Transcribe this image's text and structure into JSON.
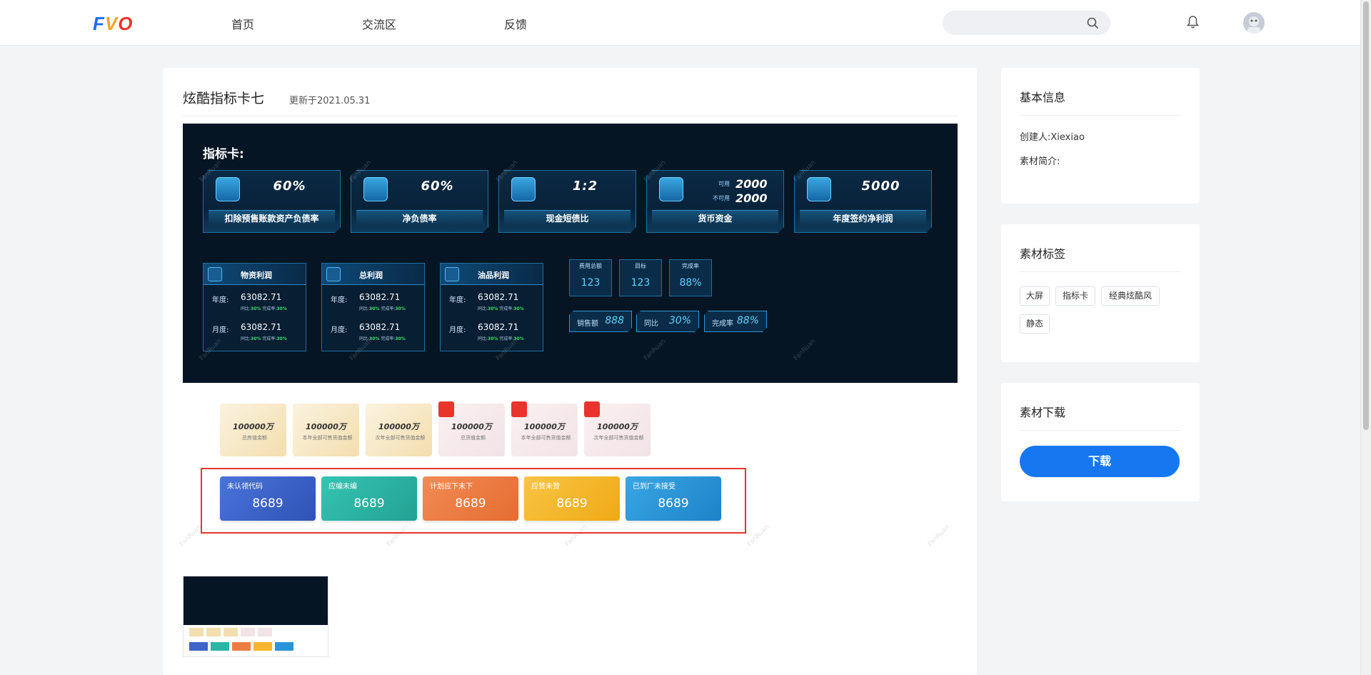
{
  "header": {
    "logo": {
      "p1": "F",
      "p2": "V",
      "p3": "O"
    },
    "nav": [
      {
        "label": "首页"
      },
      {
        "label": "交流区"
      },
      {
        "label": "反馈"
      }
    ],
    "search": {
      "placeholder": ""
    }
  },
  "detail": {
    "title": "炫酷指标卡七",
    "updated": "更新于2021.05.31"
  },
  "preview": {
    "heading": "指标卡:",
    "watermark": "FanRuan",
    "kpis": [
      {
        "value": "60%",
        "label": "扣除预售账款资产负债率"
      },
      {
        "value": "60%",
        "label": "净负债率"
      },
      {
        "value": "1:2",
        "label": "现金短债比"
      },
      {
        "label": "货币资金",
        "rows": [
          {
            "l": "可用",
            "v": "2000"
          },
          {
            "l": "不可用",
            "v": "2000"
          }
        ]
      },
      {
        "value": "5000",
        "label": "年度签约净利润"
      }
    ],
    "profit_cards": [
      {
        "title": "物资利润",
        "year_label": "年度:",
        "year_value": "63082.71",
        "month_label": "月度:",
        "month_value": "63082.71",
        "yoy_label": "同比:",
        "yoy": "30%",
        "rate_label": "完成率:",
        "rate": "30%"
      },
      {
        "title": "总利润",
        "year_label": "年度:",
        "year_value": "63082.71",
        "month_label": "月度:",
        "month_value": "63082.71",
        "yoy_label": "同比:",
        "yoy": "30%",
        "rate_label": "完成率:",
        "rate": "30%"
      },
      {
        "title": "油品利润",
        "year_label": "年度:",
        "year_value": "63082.71",
        "month_label": "月度:",
        "month_value": "63082.71",
        "yoy_label": "同比:",
        "yoy": "30%",
        "rate_label": "完成率:",
        "rate": "30%"
      }
    ],
    "minis": [
      {
        "label": "费用总额",
        "value": "123"
      },
      {
        "label": "目标",
        "value": "123"
      },
      {
        "label": "完成率",
        "value": "88%"
      }
    ],
    "pills": [
      {
        "label": "销售额",
        "value": "888"
      },
      {
        "label": "同比",
        "value": "30%"
      },
      {
        "label": "完成率",
        "value": "88%"
      }
    ],
    "light_cards": [
      {
        "value": "100000万",
        "label": "总房值金额"
      },
      {
        "value": "100000万",
        "label": "本年全部可售货值金额"
      },
      {
        "value": "100000万",
        "label": "次年全部可售货值金额"
      },
      {
        "value": "100000万",
        "label": "总货值金额"
      },
      {
        "value": "100000万",
        "label": "本年全部可售货值金额"
      },
      {
        "value": "100000万",
        "label": "次年全部可售货值金额"
      }
    ],
    "color_cards": [
      {
        "title": "未认领代码",
        "value": "8689"
      },
      {
        "title": "应编未编",
        "value": "8689"
      },
      {
        "title": "计划应下未下",
        "value": "8689"
      },
      {
        "title": "应赞未赞",
        "value": "8689"
      },
      {
        "title": "已到厂未接受",
        "value": "8689"
      }
    ]
  },
  "sidebar": {
    "basic": {
      "heading": "基本信息",
      "creator": "创建人:Xiexiao",
      "intro": "素材简介:"
    },
    "tags": {
      "heading": "素材标签",
      "items": [
        "大屏",
        "指标卡",
        "经典炫酷风",
        "静态"
      ]
    },
    "download": {
      "heading": "素材下载",
      "button": "下载"
    }
  },
  "colors": {
    "accent": "#1677f0",
    "highlight": "#e8342c",
    "cards": [
      "#3d64c9",
      "#2bb5a6",
      "#ee7d43",
      "#f6b52c",
      "#2a94d8"
    ]
  }
}
